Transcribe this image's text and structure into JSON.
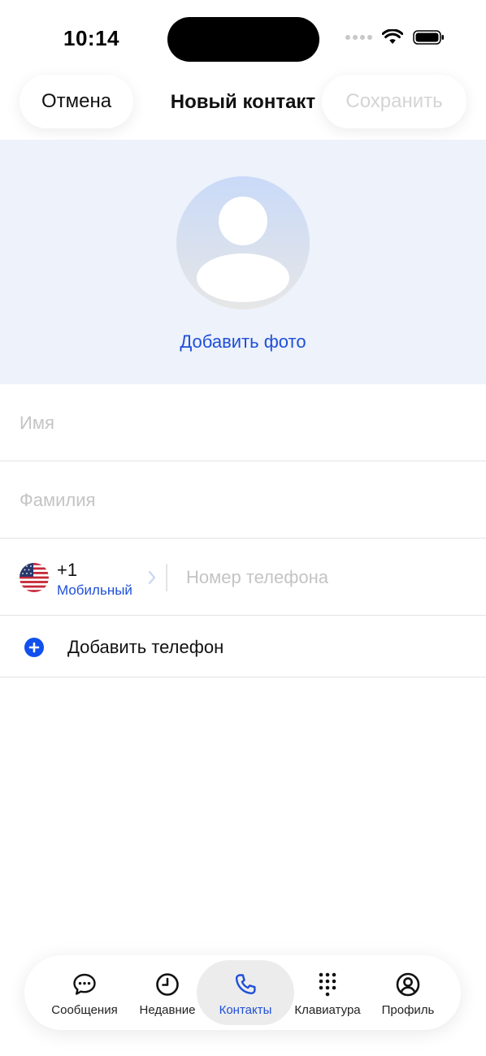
{
  "status_bar": {
    "time": "10:14"
  },
  "header": {
    "cancel_label": "Отмена",
    "title": "Новый контакт",
    "save_label": "Сохранить"
  },
  "photo": {
    "add_photo_label": "Добавить фото"
  },
  "form": {
    "first_name": {
      "placeholder": "Имя",
      "value": ""
    },
    "last_name": {
      "placeholder": "Фамилия",
      "value": ""
    },
    "phone": {
      "country_flag": "us-flag-icon",
      "dial_code": "+1",
      "type_label": "Мобильный",
      "placeholder": "Номер телефона",
      "value": ""
    },
    "add_phone_label": "Добавить телефон"
  },
  "tab_bar": {
    "items": [
      {
        "label": "Сообщения",
        "icon": "message-bubble-icon",
        "active": false
      },
      {
        "label": "Недавние",
        "icon": "clock-icon",
        "active": false
      },
      {
        "label": "Контакты",
        "icon": "phone-icon",
        "active": true
      },
      {
        "label": "Клавиатура",
        "icon": "keypad-icon",
        "active": false
      },
      {
        "label": "Профиль",
        "icon": "profile-icon",
        "active": false
      }
    ]
  },
  "colors": {
    "accent": "#1f4fd8",
    "photo_bg": "#edf2fb",
    "placeholder": "#c4c4c4",
    "divider": "#e4e4e4"
  }
}
